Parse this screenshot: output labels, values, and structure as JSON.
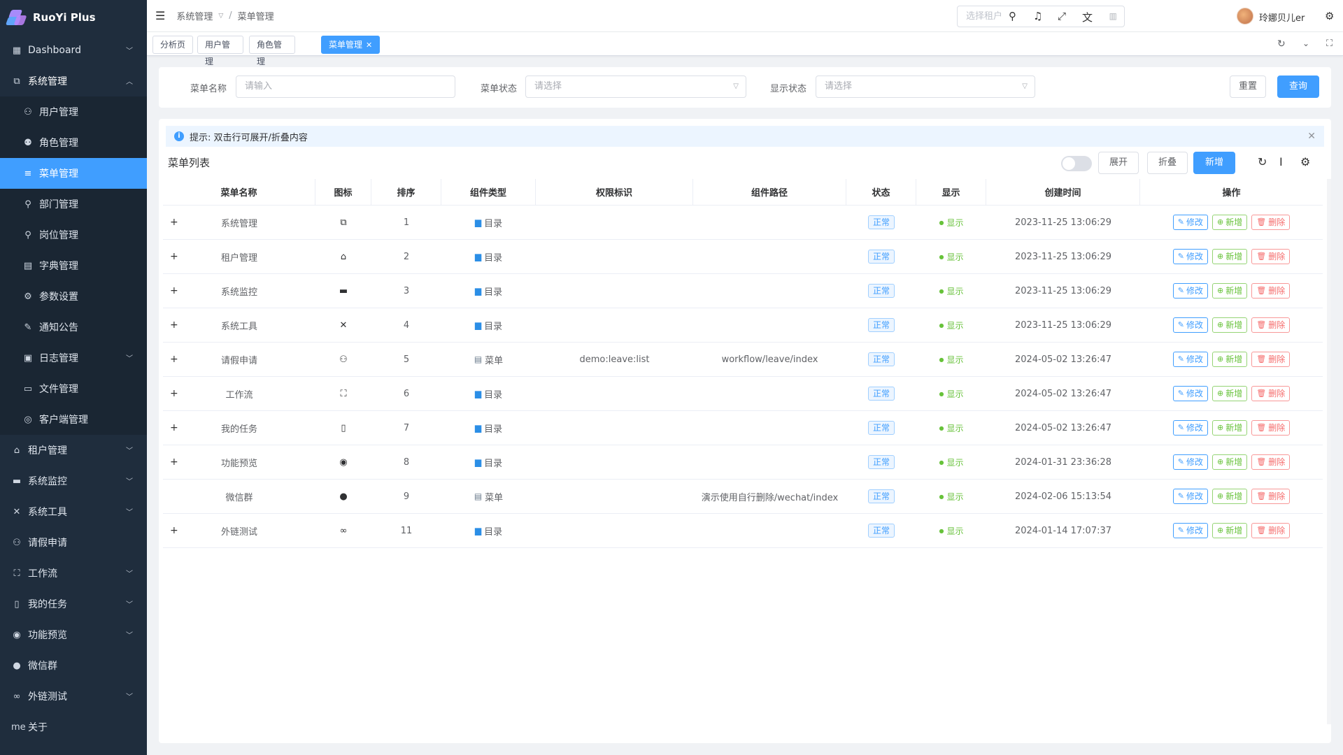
{
  "app": {
    "title": "RuoYi Plus"
  },
  "sidebar": {
    "items": [
      {
        "label": "Dashboard",
        "icon": "grid-icon",
        "glyph": "▦",
        "chevron": true
      },
      {
        "label": "系统管理",
        "icon": "monitor-cog-icon",
        "glyph": "⧉",
        "chevron": true,
        "open": true
      }
    ],
    "sub": [
      {
        "label": "用户管理",
        "icon": "user-icon",
        "glyph": "⚇"
      },
      {
        "label": "角色管理",
        "icon": "role-icon",
        "glyph": "⚉"
      },
      {
        "label": "菜单管理",
        "icon": "menu-list-icon",
        "glyph": "≡",
        "active": true
      },
      {
        "label": "部门管理",
        "icon": "dept-icon",
        "glyph": "⚲"
      },
      {
        "label": "岗位管理",
        "icon": "post-icon",
        "glyph": "⚲"
      },
      {
        "label": "字典管理",
        "icon": "dict-icon",
        "glyph": "▤"
      },
      {
        "label": "参数设置",
        "icon": "settings-icon",
        "glyph": "⚙"
      },
      {
        "label": "通知公告",
        "icon": "notice-icon",
        "glyph": "✎"
      },
      {
        "label": "日志管理",
        "icon": "log-icon",
        "glyph": "▣",
        "chevron": true
      },
      {
        "label": "文件管理",
        "icon": "file-icon",
        "glyph": "▭"
      },
      {
        "label": "客户端管理",
        "icon": "client-icon",
        "glyph": "◎"
      }
    ],
    "rest": [
      {
        "label": "租户管理",
        "icon": "home-icon",
        "glyph": "⌂",
        "chevron": true
      },
      {
        "label": "系统监控",
        "icon": "monitor-icon",
        "glyph": "▬",
        "chevron": true
      },
      {
        "label": "系统工具",
        "icon": "tools-icon",
        "glyph": "✕",
        "chevron": true
      },
      {
        "label": "请假申请",
        "icon": "leave-user-icon",
        "glyph": "⚇",
        "chevron": false
      },
      {
        "label": "工作流",
        "icon": "workflow-icon",
        "glyph": "⛶",
        "chevron": true
      },
      {
        "label": "我的任务",
        "icon": "task-icon",
        "glyph": "▯",
        "chevron": true
      },
      {
        "label": "功能预览",
        "icon": "preview-icon",
        "glyph": "◉",
        "chevron": true
      },
      {
        "label": "微信群",
        "icon": "wechat-icon",
        "glyph": "●",
        "chevron": false
      },
      {
        "label": "外链测试",
        "icon": "link-icon",
        "glyph": "∞",
        "chevron": true
      },
      {
        "label": "关于",
        "icon": "about-me-icon",
        "glyph": "me",
        "chevron": false
      }
    ]
  },
  "topbar": {
    "breadcrumb": [
      "系统管理",
      "菜单管理"
    ],
    "tenant_placeholder": "选择租户",
    "username": "玲娜贝儿er"
  },
  "tags": [
    {
      "label": "分析页"
    },
    {
      "label": "用户管理"
    },
    {
      "label": "角色管理"
    },
    {
      "label": "菜单管理",
      "active": true
    }
  ],
  "search": {
    "name_label": "菜单名称",
    "name_placeholder": "请输入",
    "status_label": "菜单状态",
    "status_placeholder": "请选择",
    "visible_label": "显示状态",
    "visible_placeholder": "请选择",
    "reset": "重置",
    "query": "查询"
  },
  "table_card": {
    "tip": "提示: 双击行可展开/折叠内容",
    "title": "菜单列表",
    "expand": "展开",
    "collapse": "折叠",
    "add": "新增"
  },
  "table": {
    "columns": [
      "菜单名称",
      "图标",
      "排序",
      "组件类型",
      "权限标识",
      "组件路径",
      "状态",
      "显示",
      "创建时间",
      "操作"
    ],
    "rows": [
      {
        "name": "系统管理",
        "icon": "monitor-cog-icon",
        "glyph": "⧉",
        "order": "1",
        "type": "目录",
        "type_icon": "folder",
        "perm": "",
        "path": "",
        "status": "正常",
        "show": "显示",
        "time": "2023-11-25 13:06:29",
        "expandable": true
      },
      {
        "name": "租户管理",
        "icon": "home-icon",
        "glyph": "⌂",
        "order": "2",
        "type": "目录",
        "type_icon": "folder",
        "perm": "",
        "path": "",
        "status": "正常",
        "show": "显示",
        "time": "2023-11-25 13:06:29",
        "expandable": true
      },
      {
        "name": "系统监控",
        "icon": "monitor-icon",
        "glyph": "▬",
        "order": "3",
        "type": "目录",
        "type_icon": "folder",
        "perm": "",
        "path": "",
        "status": "正常",
        "show": "显示",
        "time": "2023-11-25 13:06:29",
        "expandable": true
      },
      {
        "name": "系统工具",
        "icon": "tools-icon",
        "glyph": "✕",
        "order": "4",
        "type": "目录",
        "type_icon": "folder",
        "perm": "",
        "path": "",
        "status": "正常",
        "show": "显示",
        "time": "2023-11-25 13:06:29",
        "expandable": true
      },
      {
        "name": "请假申请",
        "icon": "leave-user-icon",
        "glyph": "⚇",
        "order": "5",
        "type": "菜单",
        "type_icon": "book",
        "perm": "demo:leave:list",
        "path": "workflow/leave/index",
        "status": "正常",
        "show": "显示",
        "time": "2024-05-02 13:26:47",
        "expandable": true
      },
      {
        "name": "工作流",
        "icon": "workflow-icon",
        "glyph": "⛶",
        "order": "6",
        "type": "目录",
        "type_icon": "folder",
        "perm": "",
        "path": "",
        "status": "正常",
        "show": "显示",
        "time": "2024-05-02 13:26:47",
        "expandable": true
      },
      {
        "name": "我的任务",
        "icon": "task-icon",
        "glyph": "▯",
        "order": "7",
        "type": "目录",
        "type_icon": "folder",
        "perm": "",
        "path": "",
        "status": "正常",
        "show": "显示",
        "time": "2024-05-02 13:26:47",
        "expandable": true
      },
      {
        "name": "功能预览",
        "icon": "preview-icon",
        "glyph": "◉",
        "order": "8",
        "type": "目录",
        "type_icon": "folder",
        "perm": "",
        "path": "",
        "status": "正常",
        "show": "显示",
        "time": "2024-01-31 23:36:28",
        "expandable": true
      },
      {
        "name": "微信群",
        "icon": "wechat-icon",
        "glyph": "●",
        "order": "9",
        "type": "菜单",
        "type_icon": "book",
        "perm": "",
        "path": "演示使用自行删除/wechat/index",
        "status": "正常",
        "show": "显示",
        "time": "2024-02-06 15:13:54",
        "expandable": false
      },
      {
        "name": "外链测试",
        "icon": "link-icon",
        "glyph": "∞",
        "order": "11",
        "type": "目录",
        "type_icon": "folder",
        "perm": "",
        "path": "",
        "status": "正常",
        "show": "显示",
        "time": "2024-01-14 17:07:37",
        "expandable": true
      }
    ],
    "ops": {
      "edit": "修改",
      "add": "新增",
      "delete": "删除"
    }
  },
  "colors": {
    "primary": "#409eff",
    "sidebar": "#1f2d3d",
    "success": "#67c23a",
    "danger": "#f56c6c"
  }
}
